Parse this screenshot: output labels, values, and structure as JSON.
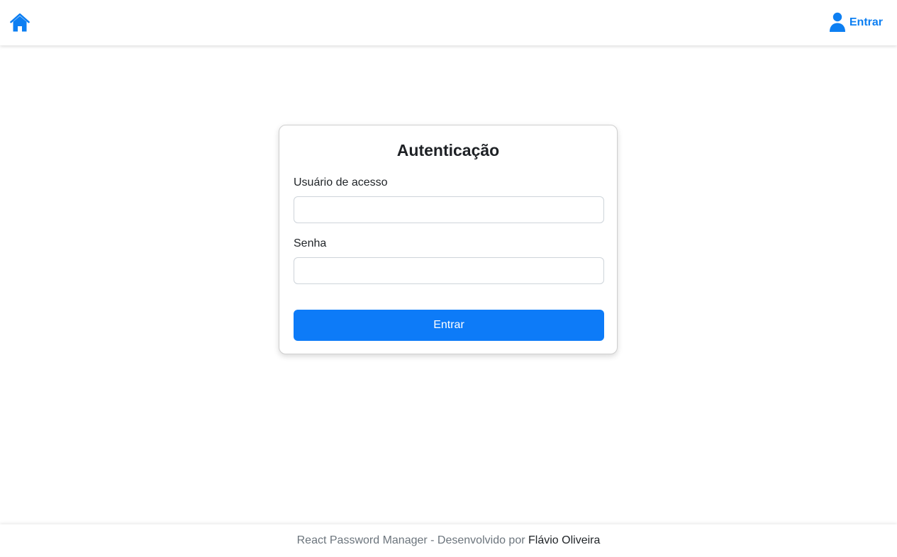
{
  "navbar": {
    "home_icon": "home-icon",
    "login_icon": "user-icon",
    "login_label": "Entrar",
    "accent_color": "#0d7ff2"
  },
  "login_form": {
    "title": "Autenticação",
    "username_label": "Usuário de acesso",
    "username_value": "",
    "password_label": "Senha",
    "password_value": "",
    "submit_label": "Entrar",
    "submit_color": "#0d7bf8"
  },
  "footer": {
    "text": "React Password Manager - Desenvolvido por",
    "author": "Flávio Oliveira"
  }
}
